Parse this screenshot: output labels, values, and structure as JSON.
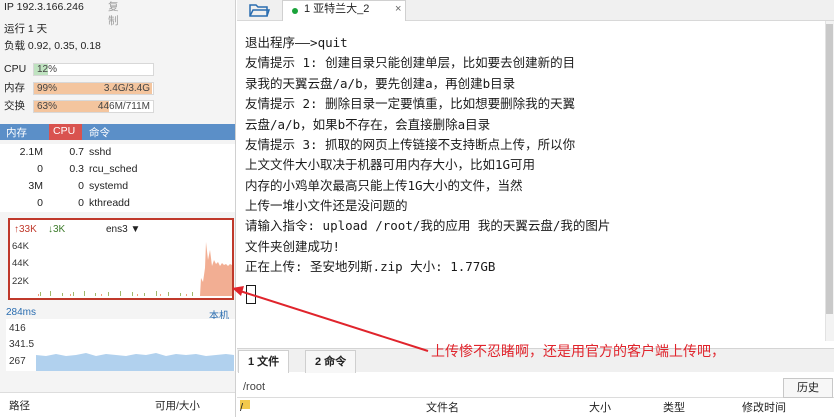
{
  "server": {
    "ip": "IP 192.3.166.246",
    "copy_label": "复制",
    "uptime": "运行 1 天",
    "load": "负载 0.92, 0.35, 0.18"
  },
  "meters": {
    "cpu": {
      "label": "CPU",
      "percent_text": "12%",
      "value": "",
      "fraction": 0.12,
      "color": "#bfe3c0"
    },
    "mem": {
      "label": "内存",
      "percent_text": "99%",
      "value": "3.4G/3.4G",
      "fraction": 0.99,
      "color": "#f4c59e"
    },
    "swap": {
      "label": "交换",
      "percent_text": "63%",
      "value": "446M/711M",
      "fraction": 0.63,
      "color": "#f4c59e"
    }
  },
  "process_table": {
    "headers": {
      "mem": "内存",
      "cpu": "CPU",
      "cmd": "命令"
    },
    "rows": [
      {
        "mem": "2.1M",
        "cpu": "0.7",
        "cmd": "sshd"
      },
      {
        "mem": "0",
        "cpu": "0.3",
        "cmd": "rcu_sched"
      },
      {
        "mem": "3M",
        "cpu": "0",
        "cmd": "systemd"
      },
      {
        "mem": "0",
        "cpu": "0",
        "cmd": "kthreadd"
      }
    ]
  },
  "network": {
    "up": "↑33K",
    "down": "↓3K",
    "interface": "ens3",
    "y_labels": [
      "64K",
      "44K",
      "22K"
    ],
    "upload_color": "#f0a080",
    "download_color": "#9fb86a"
  },
  "latency": {
    "label": "284ms",
    "right_label": "本机",
    "y_labels": [
      "416",
      "341.5",
      "267"
    ],
    "color": "#9ec5ea"
  },
  "left_bottom": {
    "path_header": "路径",
    "avail_header": "可用/大小"
  },
  "tabs": {
    "active": "1 亚特兰大_2",
    "close": "×"
  },
  "terminal": {
    "lines": [
      "退出程序——>quit",
      "友情提示 1: 创建目录只能创建单层，比如要去创建新的目",
      "录我的天翼云盘/a/b，要先创建a，再创建b目录",
      "友情提示 2: 删除目录一定要慎重，比如想要删除我的天翼",
      "云盘/a/b，如果b不存在，会直接删除a目录",
      "友情提示 3: 抓取的网页上传链接不支持断点上传，所以你",
      "上文文件大小取决于机器可用内存大小，比如1G可用",
      "内存的小鸡单次最高只能上传1G大小的文件，当然",
      "上传一堆小文件还是没问题的",
      "请输入指令: upload /root/我的应用 我的天翼云盘/我的图片",
      "文件夹创建成功!",
      "正在上传: 圣安地列斯.zip 大小: 1.77GB"
    ]
  },
  "annotation": {
    "text": "上传惨不忍睹啊，还是用官方的客户端上传吧，",
    "color": "#e0242c"
  },
  "bottom_tabs": {
    "files": "1 文件",
    "commands": "2 命令"
  },
  "file_browser": {
    "path": "/root",
    "history_button": "历史",
    "tree_root": "/",
    "headers": {
      "name": "文件名",
      "size": "大小",
      "type": "类型",
      "mtime": "修改时间"
    }
  }
}
